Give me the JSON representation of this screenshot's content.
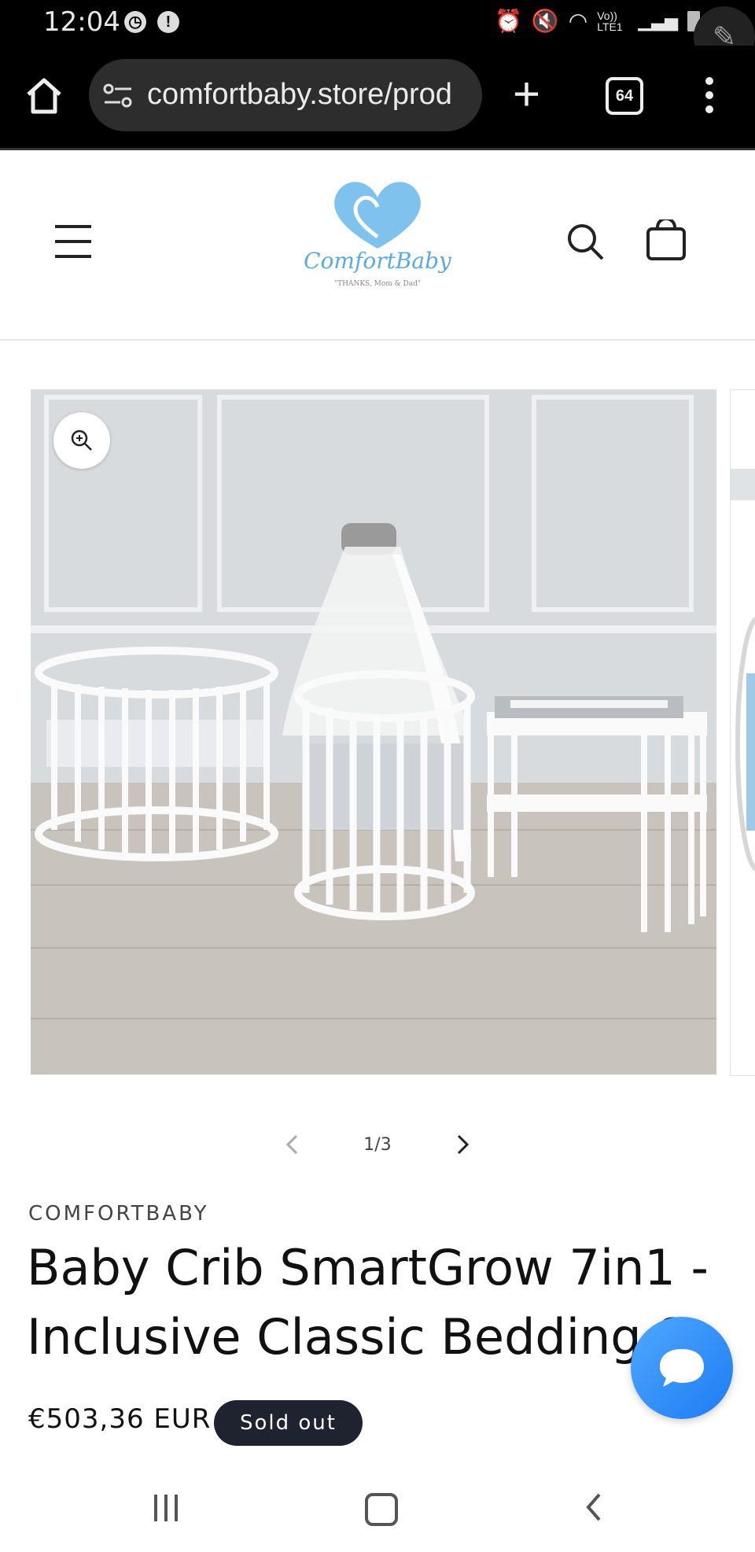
{
  "status_bar": {
    "time": "12:04",
    "network": "Vo)) LTE1"
  },
  "browser": {
    "url": "comfortbaby.store/prod",
    "tab_count": "64"
  },
  "site": {
    "logo_text": "ComfortBaby",
    "logo_tagline": "\"THANKS, Mom & Dad\""
  },
  "gallery": {
    "counter": "1/3",
    "image_alt": "White oval baby crib set with canopy, round bassinet and changing table"
  },
  "product": {
    "vendor": "COMFORTBABY",
    "title_line1": "Baby Crib SmartGrow 7in1 -",
    "title_line2": "Inclusive Classic Bedding S",
    "price": "€503,36 EUR",
    "badge": "Sold out"
  },
  "colors": {
    "brand_blue": "#7fc2ee",
    "badge_bg": "#1f2330",
    "chat_blue": "#2a8bf7"
  }
}
